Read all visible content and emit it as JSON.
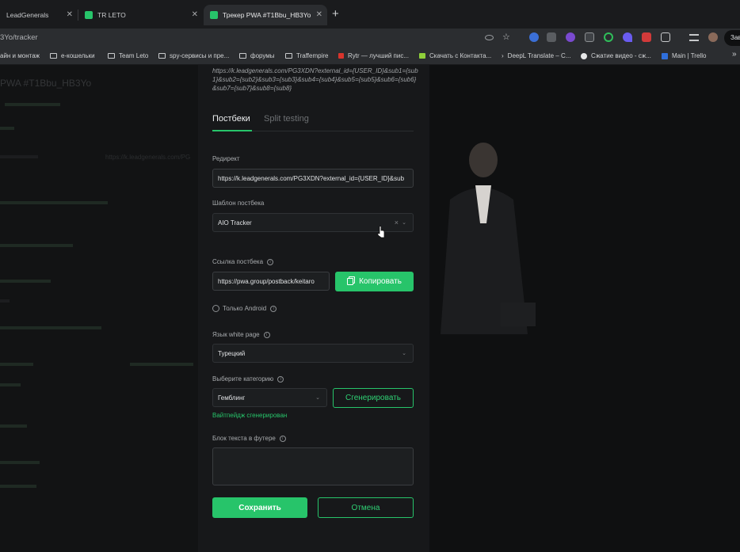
{
  "browser": {
    "tabs": [
      {
        "title": "LeadGenerals",
        "color": "#2b2d30"
      },
      {
        "title": "TR LETO",
        "color": "#27c46a"
      },
      {
        "title": "Трекер PWA #T1Bbu_HB3Yo",
        "color": "#27c46a"
      }
    ],
    "new_tab": "+",
    "url": "3Yo/tracker",
    "profile_label": "Зав",
    "bookmarks": [
      "айн и монтаж",
      "е-кошельки",
      "Team Leto",
      "spy-сервисы и пре...",
      "форумы",
      "Traffempire",
      "Rytr — лучший пис...",
      "Скачать с Контакта...",
      "DeepL Translate – C...",
      "Сжатие видео - сж...",
      "Main | Trello"
    ],
    "more_bookmarks": "»"
  },
  "background_page": {
    "title": "PWA #T1Bbu_HB3Yo",
    "ghost_url": "https://k.leadgenerals.com/PG"
  },
  "modal": {
    "url_tail": "https://k.leadgenerals.com/PG3XDN?external_id={USER_ID}&sub1={sub1}&sub2={sub2}&sub3={sub3}&sub4={sub4}&sub5={sub5}&sub6={sub6}&sub7={sub7}&sub8={sub8}",
    "tabs": {
      "postbacks": "Постбеки",
      "split": "Split testing"
    },
    "redirect": {
      "label": "Редирект",
      "value": "https://k.leadgenerals.com/PG3XDN?external_id={USER_ID}&sub"
    },
    "postback_template": {
      "label": "Шаблон постбека",
      "value": "AIO Tracker",
      "clear": "×"
    },
    "postback_link": {
      "label": "Ссылка постбека",
      "value": "https://pwa.group/postback/keitaro",
      "copy_label": "Копировать"
    },
    "android_only": {
      "label": "Только Android"
    },
    "whitepage_lang": {
      "label": "Язык white page",
      "value": "Турецкий"
    },
    "category": {
      "label": "Выберите категорию",
      "value": "Гемблинг",
      "generate_label": "Сгенерировать",
      "generated_note": "Вайтпейдж сгенерирован"
    },
    "footer_block": {
      "label": "Блок текста в футере",
      "value": ""
    },
    "save_label": "Сохранить",
    "cancel_label": "Отмена"
  },
  "colors": {
    "accent": "#27c46a",
    "bg": "#0e0f10",
    "modal_bg": "#17181a"
  }
}
